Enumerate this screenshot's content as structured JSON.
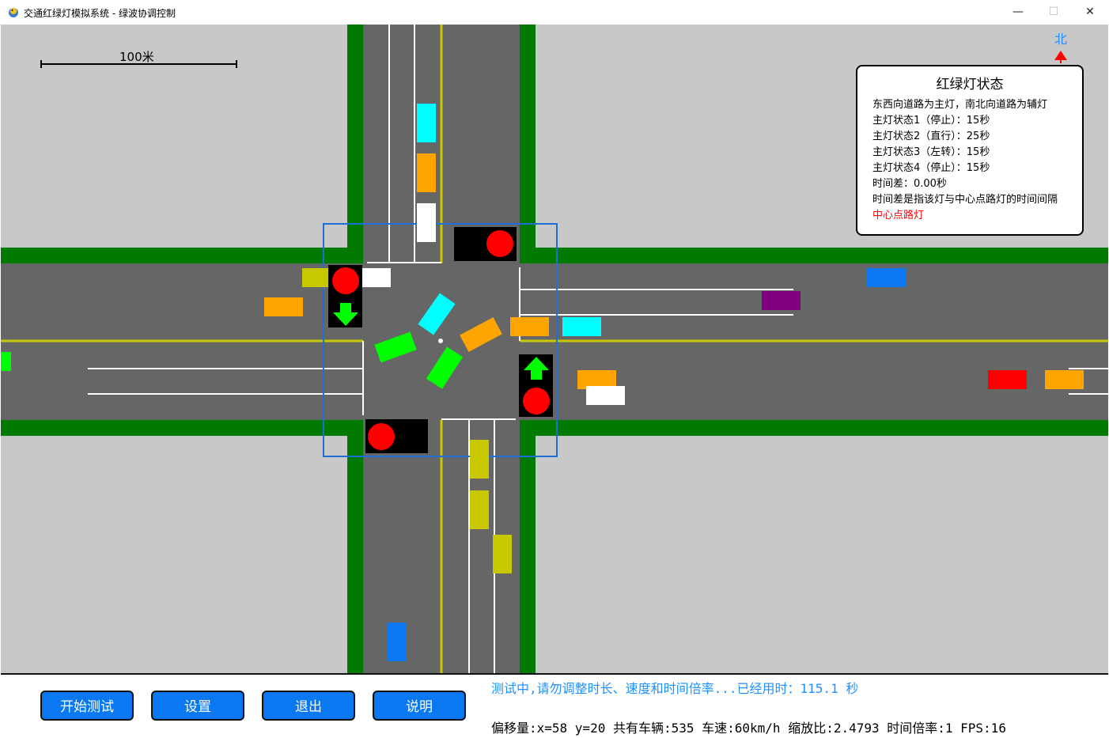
{
  "window": {
    "title": "交通红绿灯模拟系统 - 绿波协调控制",
    "minimize_glyph": "—",
    "maximize_glyph": "☐",
    "close_glyph": "✕"
  },
  "map": {
    "north_label": "北",
    "scale_label": "100米"
  },
  "info_panel": {
    "title": "红绿灯状态",
    "lines": [
      "东西向道路为主灯，南北向道路为辅灯",
      "主灯状态1（停止）：15秒",
      "主灯状态2（直行）：25秒",
      "主灯状态3（左转）：15秒",
      "主灯状态4（停止）：15秒",
      "时间差：0.00秒",
      "时间差是指该灯与中心点路灯的时间间隔"
    ],
    "highlight_line": "中心点路灯"
  },
  "buttons": {
    "start": "开始测试",
    "settings": "设置",
    "exit": "退出",
    "help": "说明"
  },
  "status": {
    "message": "测试中,请勿调整时长、速度和时间倍率...已经用时：115.1 秒",
    "detail": "偏移量:x=58 y=20 共有车辆:535  车速:60km/h 缩放比:2.4793 时间倍率:1 FPS:16"
  },
  "colors": {
    "grass": "#007a00",
    "road": "#666666",
    "background": "#c8c8c8",
    "yellow_line": "#c8c800",
    "button_blue": "#0a78f0",
    "status_blue": "#1e90ff"
  }
}
